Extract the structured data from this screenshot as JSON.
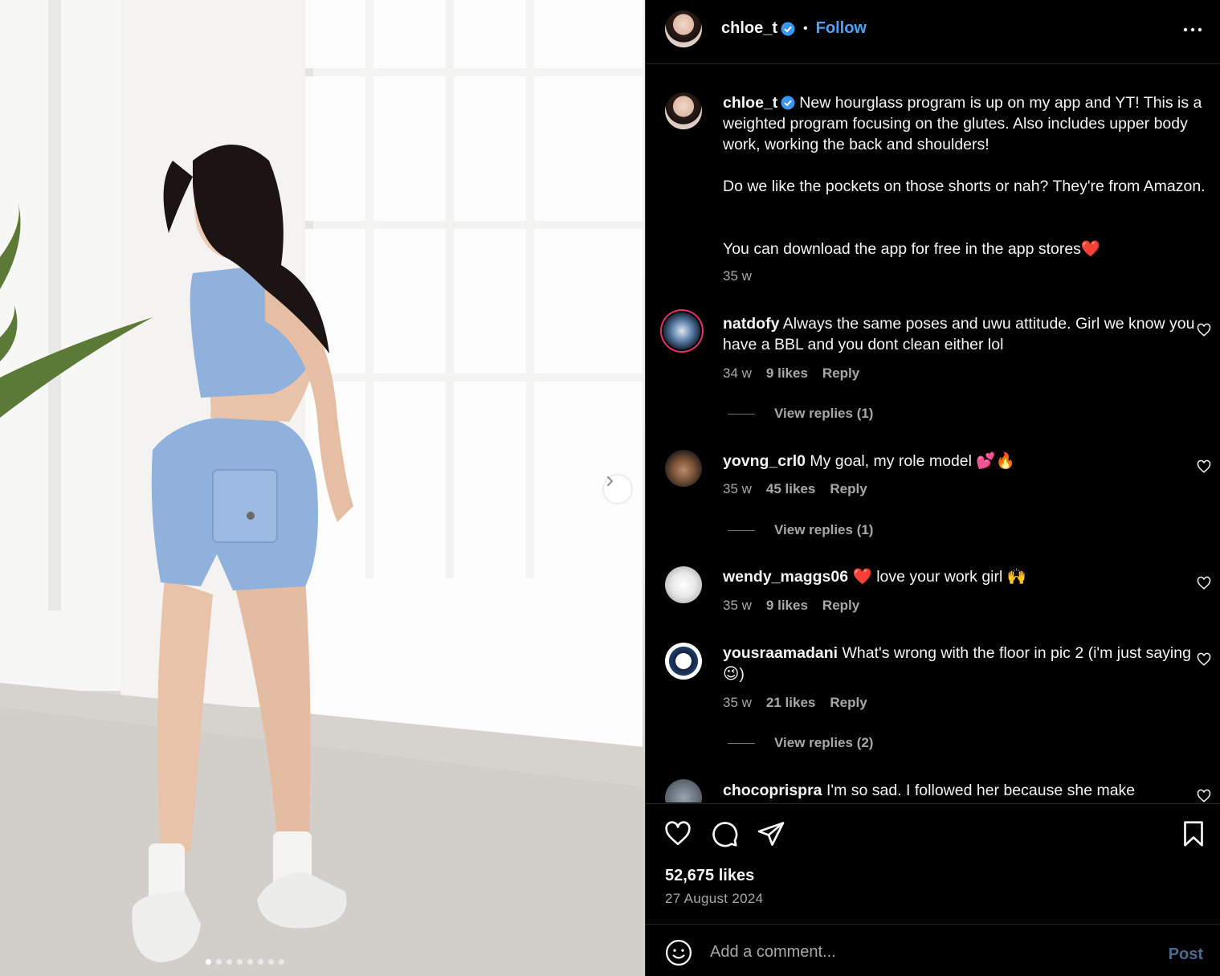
{
  "media": {
    "slide_count": 8,
    "active_slide": 1
  },
  "header": {
    "username": "chloe_t",
    "separator": "•",
    "follow_label": "Follow"
  },
  "caption": {
    "username": "chloe_t",
    "paragraphs": [
      "New hourglass program is up on my app and YT! This is a weighted program focusing on the glutes. Also includes upper body work, working the back and shoulders!",
      "Do we like the pockets on those shorts or nah? They're from Amazon.",
      "You can download the app for free in the app stores❤️"
    ],
    "time": "35 w"
  },
  "comments": [
    {
      "username": "natdofy",
      "text": "Always the same poses and uwu attitude. Girl we know you have a BBL and you dont clean either lol",
      "time": "34 w",
      "likes": "9 likes",
      "reply_label": "Reply",
      "view_replies": "View replies (1)"
    },
    {
      "username": "yovng_crl0",
      "text": "My goal, my role model 💕🔥",
      "time": "35 w",
      "likes": "45 likes",
      "reply_label": "Reply",
      "view_replies": "View replies (1)"
    },
    {
      "username": "wendy_maggs06",
      "text": "❤️ love your work girl 🙌",
      "time": "35 w",
      "likes": "9 likes",
      "reply_label": "Reply",
      "view_replies": ""
    },
    {
      "username": "yousraamadani",
      "text": "What's wrong with the floor in pic 2 (i'm just saying😉)",
      "time": "35 w",
      "likes": "21 likes",
      "reply_label": "Reply",
      "view_replies": "View replies (2)"
    },
    {
      "username": "chocoprispra",
      "text": "I'm so sad. I followed her because she make",
      "time": "",
      "likes": "",
      "reply_label": "",
      "view_replies": ""
    }
  ],
  "actions": {
    "icons": [
      "heart-icon",
      "comment-icon",
      "share-icon",
      "bookmark-icon"
    ],
    "likes_count": "52,675 likes",
    "date": "27 August 2024"
  },
  "composer": {
    "placeholder": "Add a comment...",
    "post_label": "Post"
  },
  "colors": {
    "background": "#000000",
    "text_primary": "#f5f5f5",
    "text_secondary": "#a8a8a8",
    "link_blue": "#4aa3ff",
    "verified_blue": "#3897f0"
  }
}
